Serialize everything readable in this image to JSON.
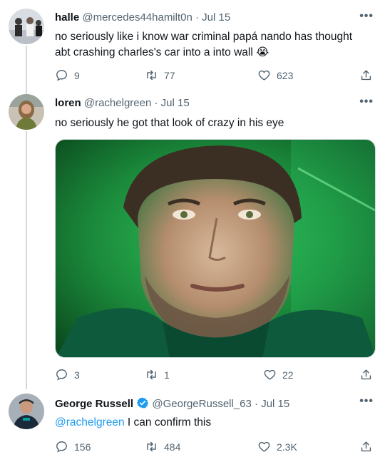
{
  "tweets": [
    {
      "name": "halle",
      "handle": "@mercedes44hamilt0n",
      "date": "Jul 15",
      "text_line1": "no seriously like i know war criminal papá nando has thought",
      "text_line2": "abt crashing charles's car into a into  wall",
      "emoji": "😭",
      "replies": "9",
      "retweets": "77",
      "likes": "623"
    },
    {
      "name": "loren",
      "handle": "@rachelgreen",
      "date": "Jul 15",
      "text": "no seriously he got that look of crazy in his eye",
      "replies": "3",
      "retweets": "1",
      "likes": "22"
    },
    {
      "name": "George Russell",
      "handle": "@GeorgeRussell_63",
      "date": "Jul 15",
      "mention": "@rachelgreen",
      "text": " I can confirm this",
      "replies": "156",
      "retweets": "484",
      "likes": "2.3K"
    }
  ],
  "separator": "·",
  "more_glyph": "•••",
  "colors": {
    "accent": "#1d9bf0",
    "muted": "#536471",
    "media_green": "#1f8a3a"
  }
}
